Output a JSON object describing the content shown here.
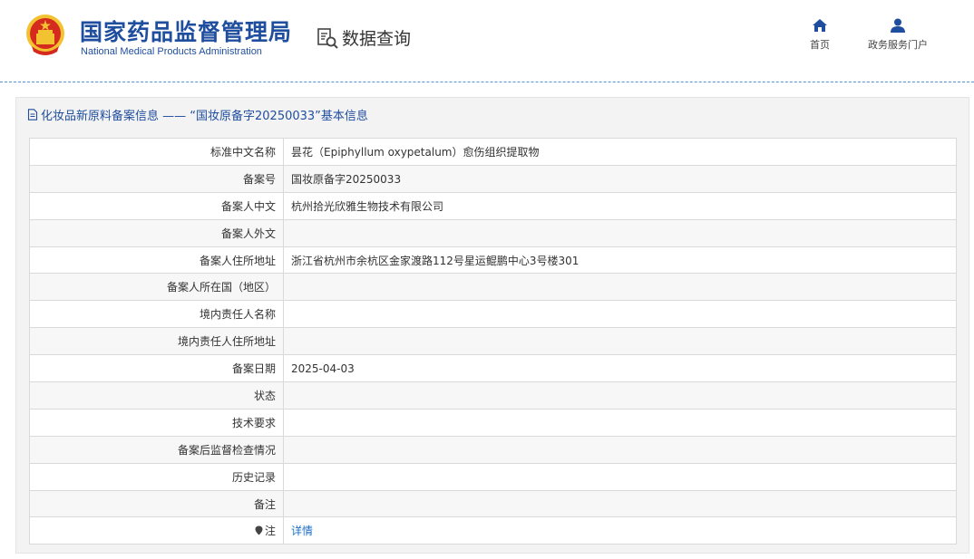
{
  "header": {
    "brand_cn": "国家药品监督管理局",
    "brand_en": "National Medical Products Administration",
    "query_label": "数据查询",
    "nav": [
      {
        "label": "首页",
        "icon": "home-icon"
      },
      {
        "label": "政务服务门户",
        "icon": "user-icon"
      }
    ]
  },
  "panel": {
    "title": "化妆品新原料备案信息 —— “国妆原备字20250033”基本信息",
    "rows": [
      {
        "label": "标准中文名称",
        "value": "昙花（Epiphyllum oxypetalum）愈伤组织提取物"
      },
      {
        "label": "备案号",
        "value": "国妆原备字20250033"
      },
      {
        "label": "备案人中文",
        "value": "杭州拾光欣雅生物技术有限公司"
      },
      {
        "label": "备案人外文",
        "value": ""
      },
      {
        "label": "备案人住所地址",
        "value": "浙江省杭州市余杭区金家渡路112号星运鲲鹏中心3号楼301"
      },
      {
        "label": "备案人所在国（地区）",
        "value": ""
      },
      {
        "label": "境内责任人名称",
        "value": ""
      },
      {
        "label": "境内责任人住所地址",
        "value": ""
      },
      {
        "label": "备案日期",
        "value": "2025-04-03"
      },
      {
        "label": "状态",
        "value": ""
      },
      {
        "label": "技术要求",
        "value": ""
      },
      {
        "label": "备案后监督检查情况",
        "value": ""
      },
      {
        "label": "历史记录",
        "value": ""
      },
      {
        "label": "备注",
        "value": ""
      }
    ],
    "note_label": "注",
    "note_link": "详情"
  },
  "colors": {
    "brand_blue": "#1f4e9e",
    "link_blue": "#1f6fc4",
    "emblem_red": "#d52b1e",
    "emblem_gold": "#f2c230"
  }
}
